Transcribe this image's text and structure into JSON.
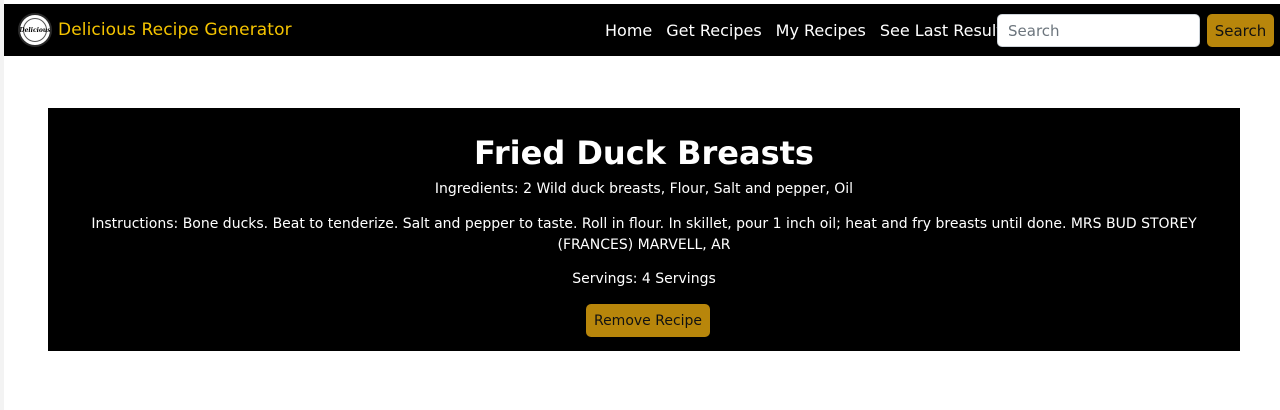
{
  "navbar": {
    "logo_text": "Delicious",
    "brand_title": "Delicious Recipe Generator",
    "links": [
      {
        "label": "Home"
      },
      {
        "label": "Get Recipes"
      },
      {
        "label": "My Recipes"
      },
      {
        "label": "See Last Results"
      }
    ],
    "search": {
      "placeholder": "Search",
      "value": "",
      "button_label": "Search"
    }
  },
  "recipe": {
    "title": "Fried Duck Breasts",
    "ingredients": "Ingredients: 2 Wild duck breasts, Flour, Salt and pepper, Oil",
    "instructions": "Instructions: Bone ducks. Beat to tenderize. Salt and pepper to taste. Roll in flour. In skillet, pour 1 inch oil; heat and fry breasts until done. MRS BUD STOREY (FRANCES) MARVELL, AR",
    "servings": "Servings: 4 Servings",
    "remove_label": "Remove Recipe"
  },
  "colors": {
    "navbar_bg": "#000000",
    "brand_color": "#f5c400",
    "accent_button": "#b8860b",
    "card_bg": "#000000",
    "page_bg": "#ffffff"
  },
  "icons": {
    "logo": "delicious-logo-icon"
  }
}
